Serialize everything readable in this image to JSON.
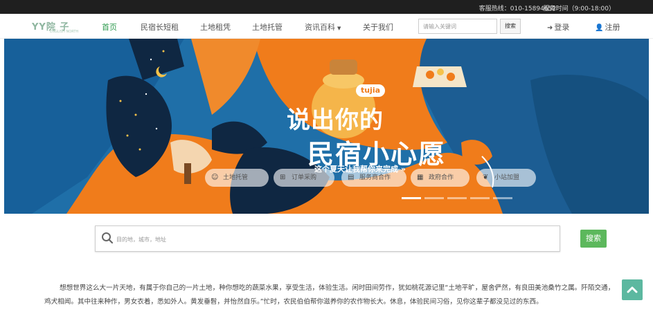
{
  "topbar": {
    "hotline": "客服热线：010-15894652",
    "hours": "服务时间（9:00-18:00）"
  },
  "nav": {
    "logo": "YY院 子",
    "logo_sub": "ENGLISH NORTH",
    "items": [
      {
        "label": "首页",
        "active": true
      },
      {
        "label": "民宿长短租"
      },
      {
        "label": "土地租凭"
      },
      {
        "label": "土地托管"
      },
      {
        "label": "资讯百科",
        "dropdown": true
      },
      {
        "label": "关于我们"
      }
    ],
    "search_placeholder": "请输入关键词",
    "search_button": "搜索",
    "login": "登录",
    "register": "注册"
  },
  "banner": {
    "badge": "tujia",
    "headline_line1": "说出你的",
    "headline_line2": "民宿小心愿",
    "headline_line3": "这个夏天让我帮你来完成 »",
    "pills": [
      {
        "label": "土地托管",
        "icon": "smile-icon"
      },
      {
        "label": "订单采购",
        "icon": "basket-icon"
      },
      {
        "label": "服务商合作",
        "icon": "document-icon"
      },
      {
        "label": "政府合作",
        "icon": "grid-icon"
      },
      {
        "label": "小站加盟",
        "icon": "leaf-icon"
      }
    ],
    "slides": 5,
    "active_slide": 1
  },
  "main_search": {
    "placeholder": "目的地，城市，地址",
    "button": "搜索"
  },
  "intro": {
    "text": "想想世界这么大一片天地，有属于你自己的一片土地，种你想吃的蔬菜水果，享受生活，体验生活。闲时田间劳作，犹如桃花源记里“土地平旷，屋舍俨然，有良田美池桑竹之属。阡陌交通，鸡犬相闻。其中往来种作，男女衣着，悉如外人。黄发垂髫，并怡然自乐。”忙时，农民伯伯帮你滋养你的农作物长大。休息，体验民间习俗，见你这辈子都没见过的东西。"
  },
  "colors": {
    "accent_green": "#2e9a4e",
    "button_green": "#5cb85c",
    "banner_blue": "#1f6fa8",
    "banner_orange": "#f07c1b",
    "totop": "#5cb8a0"
  }
}
